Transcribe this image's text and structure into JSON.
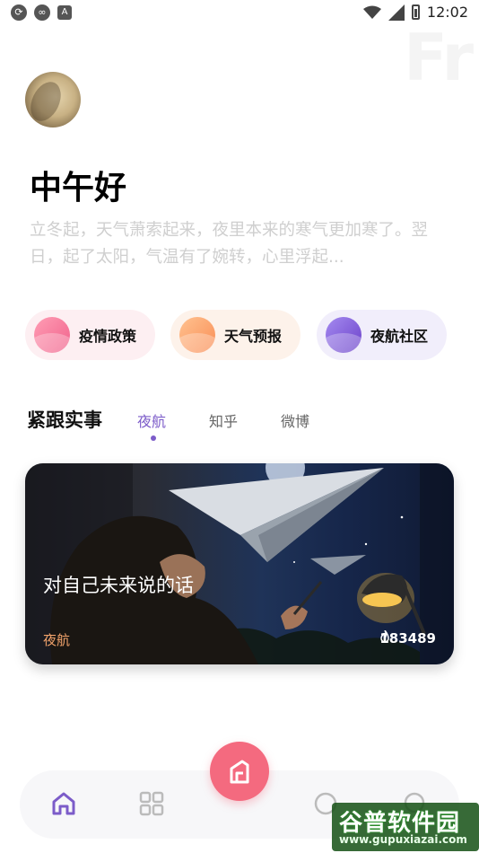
{
  "status_bar": {
    "time": "12:02",
    "left_icons": [
      "sync-icon",
      "cloud-icon",
      "font-icon"
    ],
    "right_icons": [
      "wifi-icon",
      "signal-icon",
      "battery-icon"
    ]
  },
  "header": {
    "background_word": "Fr",
    "greeting": "中午好",
    "quote": "立冬起，天气萧索起来，夜里本来的寒气更加寒了。翌日，起了太阳，气温有了婉转，心里浮起..."
  },
  "quick_links": [
    {
      "label": "疫情政策",
      "color": "#f0608a"
    },
    {
      "label": "天气预报",
      "color": "#f98d55"
    },
    {
      "label": "夜航社区",
      "color": "#6a40c9"
    }
  ],
  "section": {
    "title": "紧跟实事",
    "tabs": [
      {
        "label": "夜航",
        "active": true
      },
      {
        "label": "知乎",
        "active": false
      },
      {
        "label": "微博",
        "active": false
      }
    ]
  },
  "feature_card": {
    "title": "对自己未来说的话",
    "source": "夜航",
    "views": "183489"
  },
  "bottom_nav": {
    "items": [
      "home-icon",
      "grid-icon",
      "compose-icon",
      "circle-icon",
      "search-icon"
    ],
    "active": "home-icon",
    "accent": "#7c5cc9",
    "fab_color": "#f46a7f"
  },
  "watermark": {
    "title": "谷普软件园",
    "url": "www.gupuxiazai.com"
  }
}
